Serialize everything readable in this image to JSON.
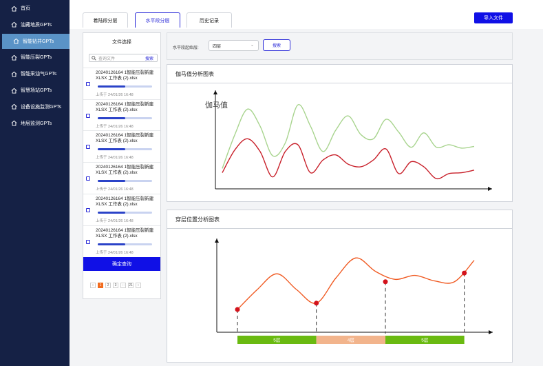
{
  "sidebar": {
    "items": [
      {
        "label": "首页",
        "icon": "home-icon",
        "active": false
      },
      {
        "label": "油藏地质GPTs",
        "icon": "home-icon",
        "active": false
      },
      {
        "label": "智能钻井GPTs",
        "icon": "home-icon",
        "active": true
      },
      {
        "label": "智能压裂GPTs",
        "icon": "home-icon",
        "active": false
      },
      {
        "label": "智能采油气GPTs",
        "icon": "home-icon",
        "active": false
      },
      {
        "label": "智慧场站GPTs",
        "icon": "home-icon",
        "active": false
      },
      {
        "label": "设备设施监测GPTs",
        "icon": "home-icon",
        "active": false
      },
      {
        "label": "地层监测GPTs",
        "icon": "home-icon",
        "active": false
      }
    ]
  },
  "tabs": [
    {
      "label": "着陆段分层",
      "active": false
    },
    {
      "label": "水平段分层",
      "active": true
    },
    {
      "label": "历史记录",
      "active": false
    }
  ],
  "import_button": "导入文件",
  "file_panel": {
    "title": "文件选择",
    "search_placeholder": "查询文件",
    "search_button": "搜索",
    "files": [
      {
        "name": "20240126164 1智能压裂新建 XLSX 工作表 (2).xlsx",
        "time": "上传于 24/01/26 16:48",
        "progress": 0.5
      },
      {
        "name": "20240126164 1智能压裂新建 XLSX 工作表 (2).xlsx",
        "time": "上传于 24/01/26 16:48",
        "progress": 0.5
      },
      {
        "name": "20240126164 1智能压裂新建 XLSX 工作表 (2).xlsx",
        "time": "上传于 24/01/26 16:48",
        "progress": 0.5
      },
      {
        "name": "20240126164 1智能压裂新建 XLSX 工作表 (2).xlsx",
        "time": "上传于 24/01/26 16:48",
        "progress": 0.5
      },
      {
        "name": "20240126164 1智能压裂新建 XLSX 工作表 (2).xlsx",
        "time": "上传于 24/01/26 16:48",
        "progress": 0.5
      },
      {
        "name": "20240126164 1智能压裂新建 XLSX 工作表 (2).xlsx",
        "time": "上传于 24/01/26 16:48",
        "progress": 0.5
      }
    ],
    "confirm_button": "确定查询",
    "pagination": [
      "‹",
      "1",
      "2",
      "3",
      "···",
      "21",
      "›"
    ],
    "current_page": "1"
  },
  "filter": {
    "label": "水平段起始层:",
    "select_value": "四层",
    "search_button": "搜索"
  },
  "gamma_panel": {
    "title": "伽马值分析图表",
    "annotation": "伽马值"
  },
  "layer_panel": {
    "title": "穿层位置分析图表"
  },
  "chart_data": [
    {
      "type": "line",
      "title": "伽马值分析图表",
      "xlabel": "",
      "ylabel": "伽马值",
      "x": [
        0,
        1,
        2,
        3,
        4,
        5,
        6,
        7,
        8,
        9,
        10,
        11,
        12,
        13,
        14,
        15,
        16,
        17,
        18,
        19,
        20
      ],
      "series": [
        {
          "color": "#a8d48e",
          "values": [
            2,
            6,
            9,
            7,
            3.5,
            5,
            9.5,
            7,
            4,
            6.5,
            8.2,
            6,
            5.5,
            7.8,
            6.3,
            4.5,
            6.2,
            4.5,
            4.8,
            4.4,
            4.6
          ]
        },
        {
          "color": "#c8202a",
          "values": [
            1.5,
            4.2,
            5.5,
            4,
            1,
            4,
            4.8,
            1.5,
            3,
            3.6,
            2.5,
            2.2,
            3,
            4.3,
            1.4,
            2.8,
            2.2,
            0.8,
            1.4,
            1.5,
            1.8
          ]
        }
      ],
      "axes_ticks": false
    },
    {
      "type": "line",
      "title": "穿层位置分析图表",
      "x": [
        0,
        1,
        2,
        3,
        4,
        5,
        6,
        7,
        8,
        9,
        10,
        11,
        12
      ],
      "series": [
        {
          "color": "#f05a22",
          "values": [
            2,
            4.5,
            6.5,
            4.5,
            2.8,
            6,
            8.5,
            6.8,
            5.8,
            6.3,
            5.6,
            5.5,
            8.2
          ]
        }
      ],
      "markers": [
        {
          "x": 0,
          "y": 2
        },
        {
          "x": 4,
          "y": 2.8
        },
        {
          "x": 7.5,
          "y": 5.5
        },
        {
          "x": 11.5,
          "y": 6.6
        }
      ],
      "bands": [
        {
          "label": "5层",
          "from": 0,
          "to": 4,
          "color": "#6aba11"
        },
        {
          "label": "4层",
          "from": 4,
          "to": 7.5,
          "color": "#f2b48c"
        },
        {
          "label": "5层",
          "from": 7.5,
          "to": 11.5,
          "color": "#6aba11"
        }
      ]
    }
  ],
  "colors": {
    "sidebar_bg": "#152145",
    "sidebar_active": "#5a93c7",
    "primary": "#1010e6",
    "accent": "#2b2bd8"
  }
}
